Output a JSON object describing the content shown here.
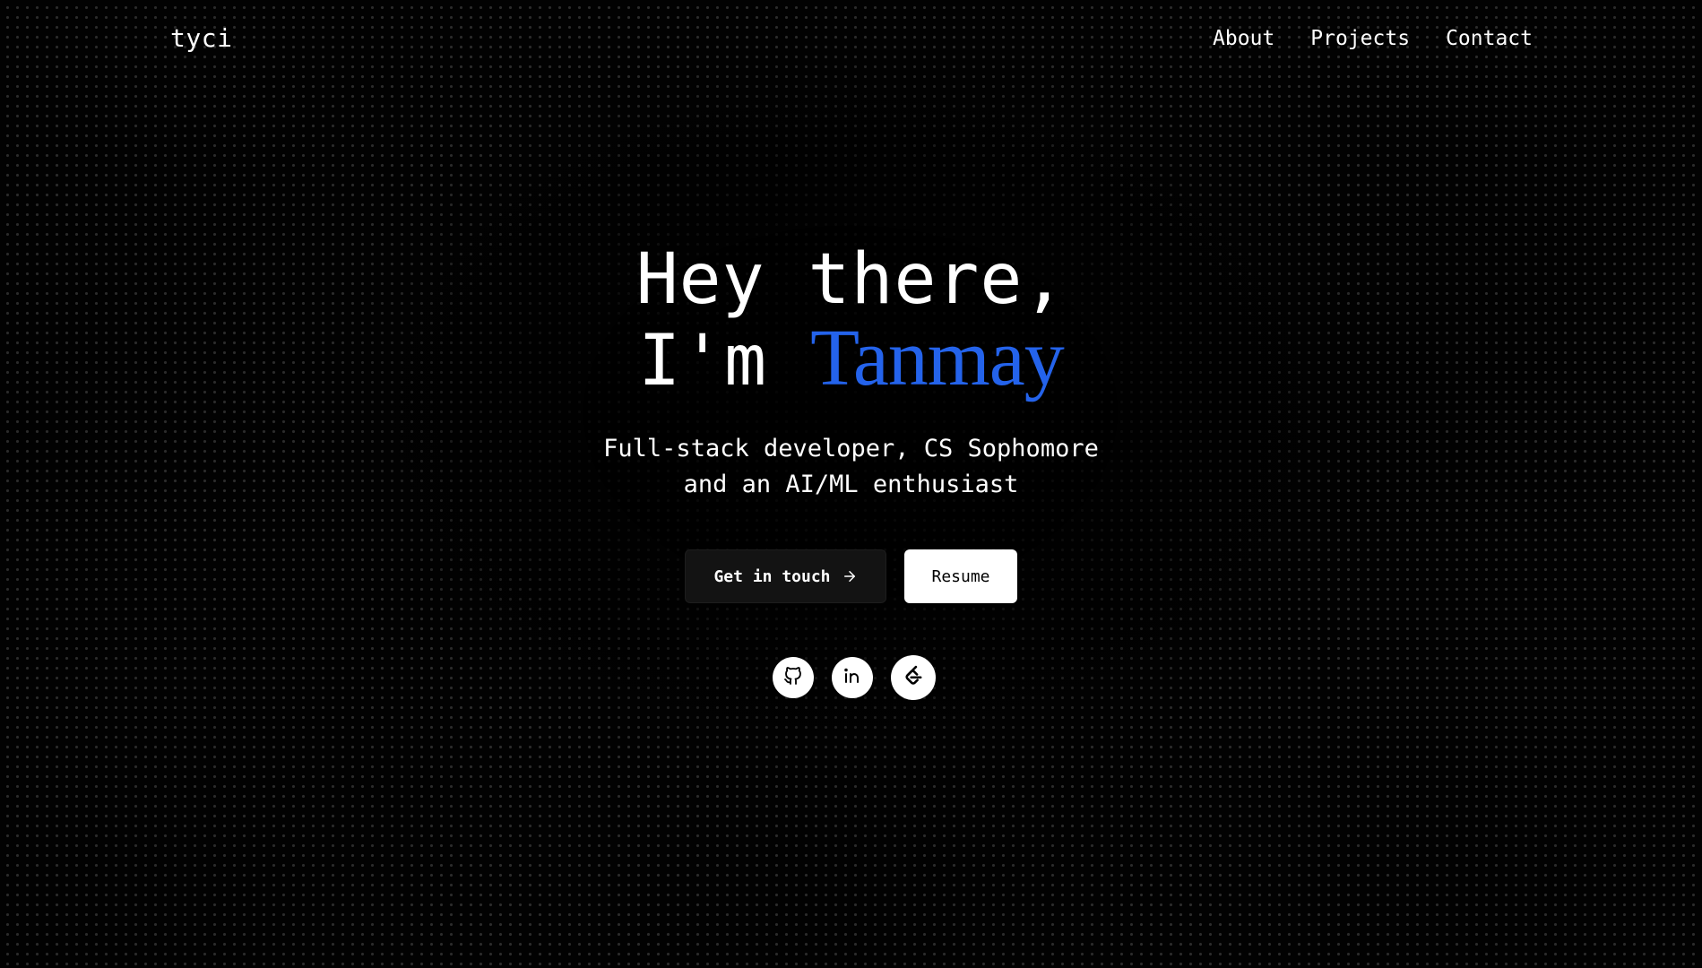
{
  "nav": {
    "logo": "tyci",
    "links": [
      {
        "label": "About"
      },
      {
        "label": "Projects"
      },
      {
        "label": "Contact"
      }
    ]
  },
  "hero": {
    "greeting_line1": "Hey there,",
    "greeting_prefix": "I'm",
    "name": "Tanmay",
    "subtitle_line1": "Full-stack developer, CS Sophomore",
    "subtitle_line2": "and an AI/ML enthusiast"
  },
  "actions": {
    "primary_label": "Get in touch",
    "primary_icon": "arrow-right-icon",
    "secondary_label": "Resume"
  },
  "socials": [
    {
      "icon": "github-icon"
    },
    {
      "icon": "linkedin-icon"
    },
    {
      "icon": "leetcode-icon"
    }
  ],
  "colors": {
    "background": "#000000",
    "accent": "#2463eb",
    "text": "#ffffff"
  }
}
